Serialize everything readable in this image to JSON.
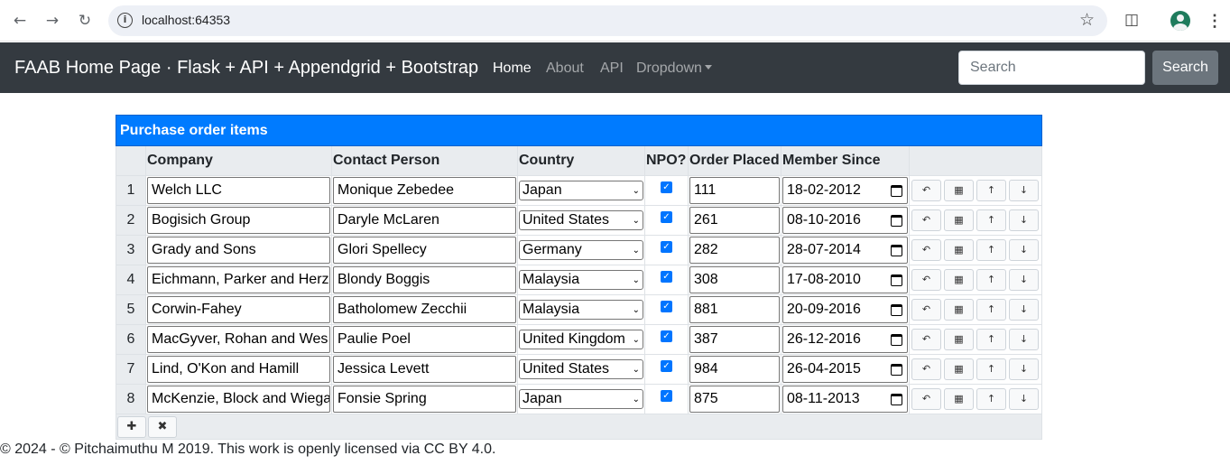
{
  "browser": {
    "url": "localhost:64353",
    "back_icon": "arrow-left-icon",
    "forward_icon": "arrow-right-icon",
    "reload_icon": "reload-icon"
  },
  "navbar": {
    "brand": "FAAB Home Page · Flask + API + Appendgrid + Bootstrap",
    "links": [
      "Home",
      "About",
      "API",
      "Dropdown"
    ],
    "search_placeholder": "Search",
    "search_button": "Search"
  },
  "grid": {
    "caption": "Purchase order items",
    "columns": [
      "Company",
      "Contact Person",
      "Country",
      "NPO?",
      "Order Placed",
      "Member Since"
    ],
    "rows": [
      {
        "num": "1",
        "company": "Welch LLC",
        "contact": "Monique Zebedee",
        "country": "Japan",
        "npo": true,
        "order": "111",
        "since": "18-02-2012"
      },
      {
        "num": "2",
        "company": "Bogisich Group",
        "contact": "Daryle McLaren",
        "country": "United States",
        "npo": true,
        "order": "261",
        "since": "08-10-2016"
      },
      {
        "num": "3",
        "company": "Grady and Sons",
        "contact": "Glori Spellecy",
        "country": "Germany",
        "npo": true,
        "order": "282",
        "since": "28-07-2014"
      },
      {
        "num": "4",
        "company": "Eichmann, Parker and Herz",
        "contact": "Blondy Boggis",
        "country": "Malaysia",
        "npo": true,
        "order": "308",
        "since": "17-08-2010"
      },
      {
        "num": "5",
        "company": "Corwin-Fahey",
        "contact": "Batholomew Zecchii",
        "country": "Malaysia",
        "npo": true,
        "order": "881",
        "since": "20-09-2016"
      },
      {
        "num": "6",
        "company": "MacGyver, Rohan and Wes",
        "contact": "Paulie Poel",
        "country": "United Kingdom",
        "npo": true,
        "order": "387",
        "since": "26-12-2016"
      },
      {
        "num": "7",
        "company": "Lind, O'Kon and Hamill",
        "contact": "Jessica Levett",
        "country": "United States",
        "npo": true,
        "order": "984",
        "since": "26-04-2015"
      },
      {
        "num": "8",
        "company": "McKenzie, Block and Wiega",
        "contact": "Fonsie Spring",
        "country": "Japan",
        "npo": true,
        "order": "875",
        "since": "08-11-2013"
      }
    ],
    "row_action_icons": [
      "insert-icon",
      "remove-icon",
      "move-up-icon",
      "move-down-icon"
    ],
    "footer_icons": [
      "append-icon",
      "remove-last-icon"
    ]
  },
  "footer": {
    "text": "© 2024 - © Pitchaimuthu M 2019. This work is openly licensed via CC BY 4.0."
  }
}
